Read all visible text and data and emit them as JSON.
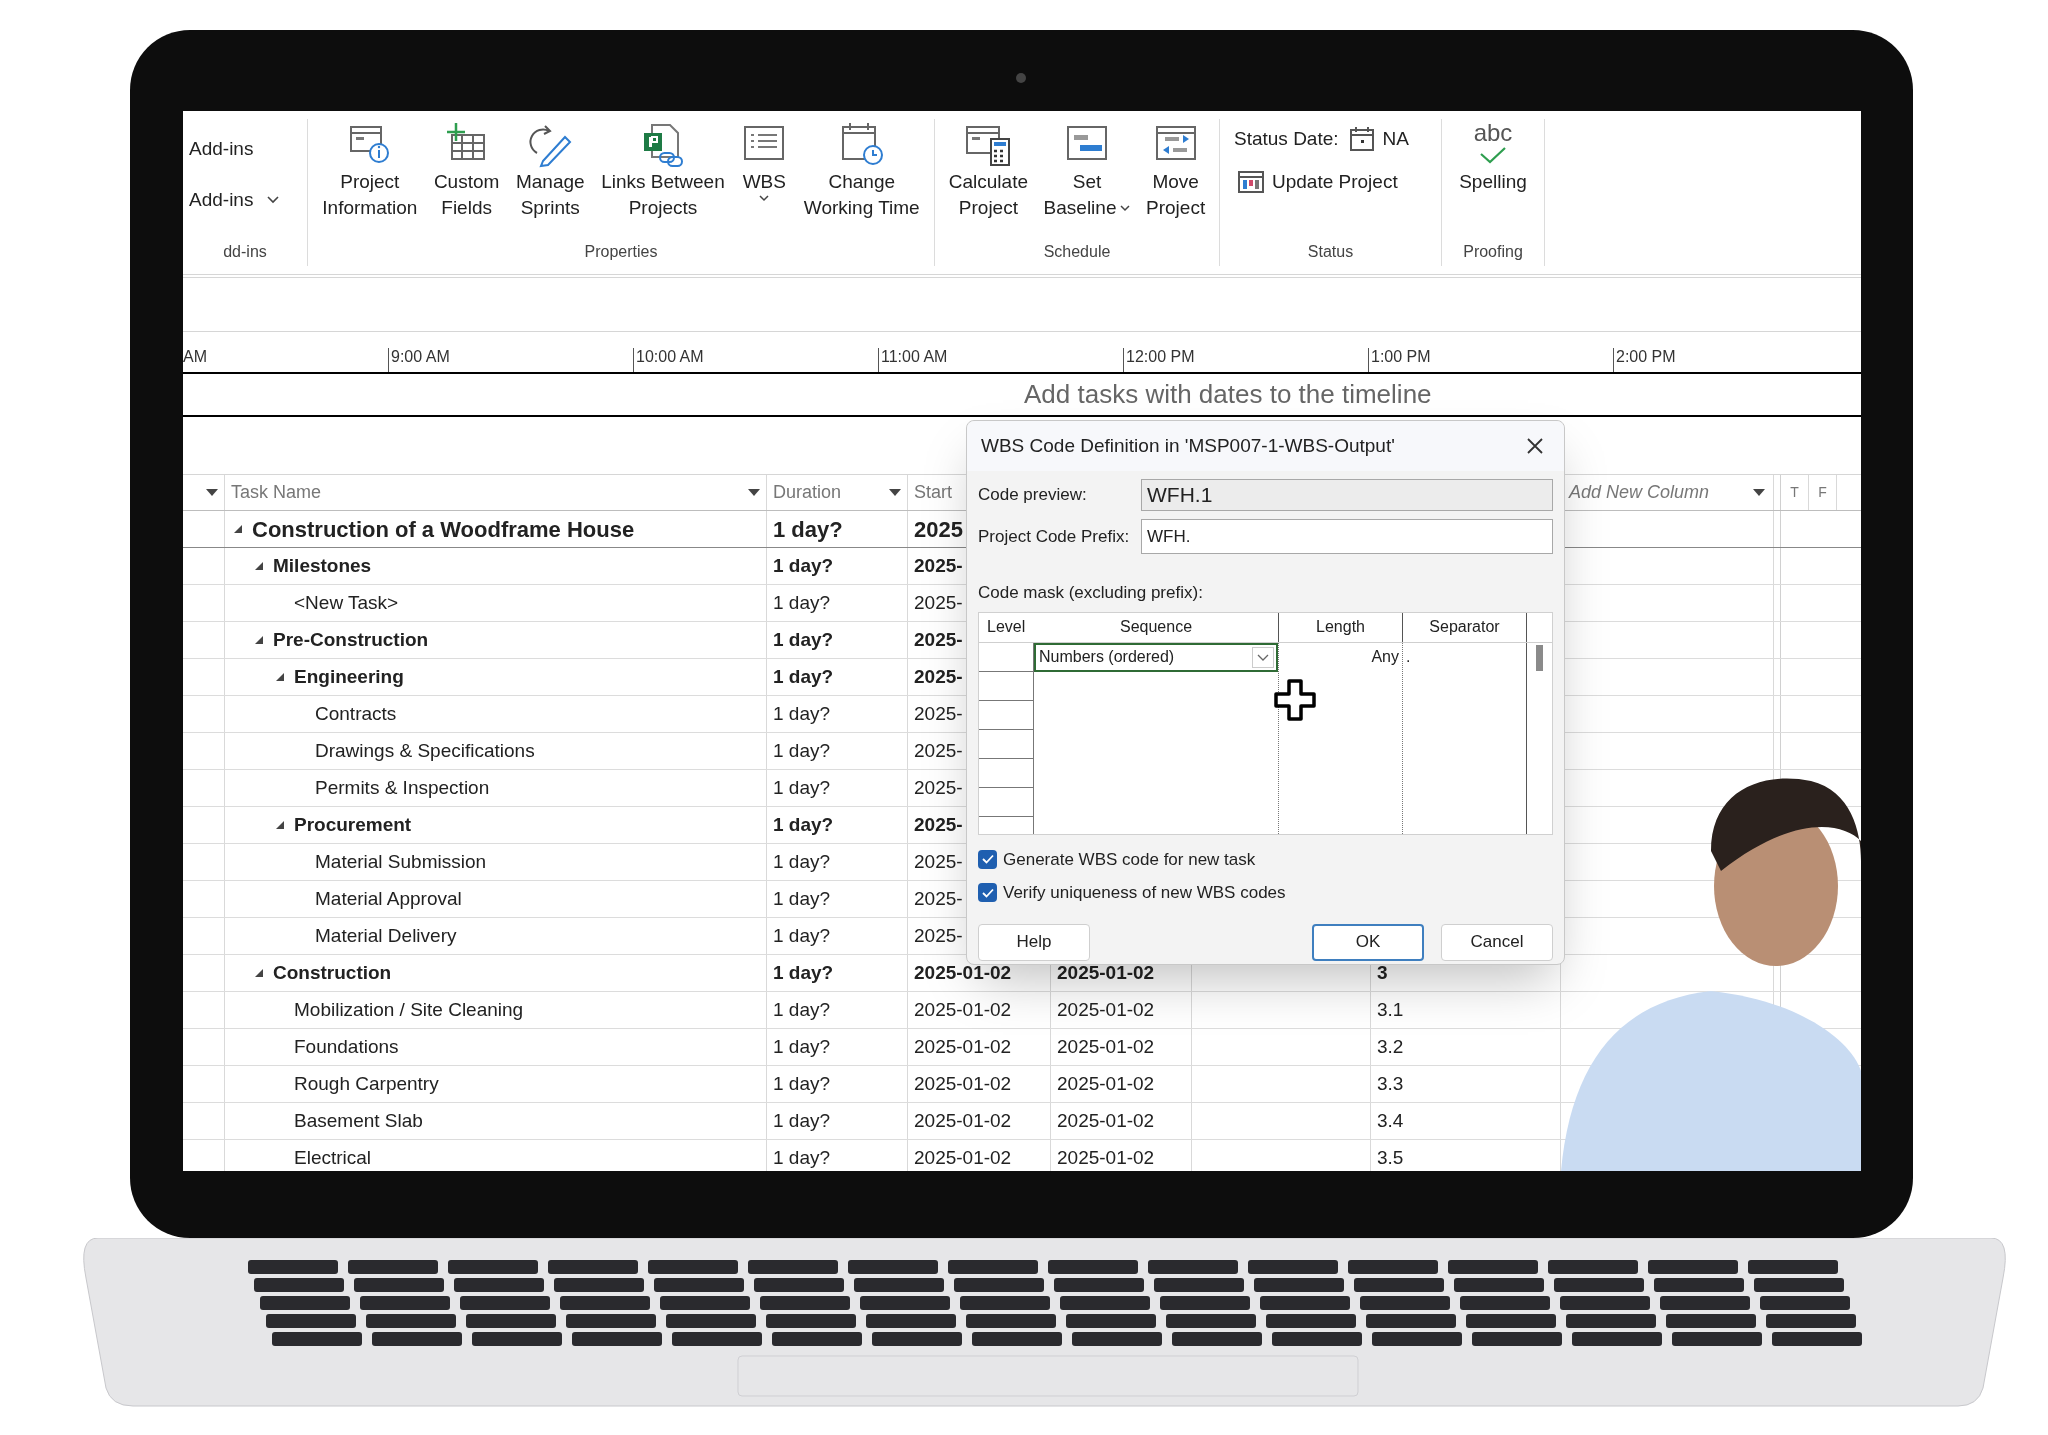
{
  "ribbon": {
    "groups": [
      {
        "label": "dd-ins",
        "kind": "small",
        "items": [
          {
            "lines": [
              "Add-ins"
            ]
          },
          {
            "lines": [
              "Add-ins"
            ],
            "dropdown": true
          }
        ]
      },
      {
        "label": "Properties",
        "kind": "large",
        "items": [
          {
            "lines": [
              "Project",
              "Information"
            ]
          },
          {
            "lines": [
              "Custom",
              "Fields"
            ]
          },
          {
            "lines": [
              "Manage",
              "Sprints"
            ]
          },
          {
            "lines": [
              "Links Between",
              "Projects"
            ]
          },
          {
            "lines": [
              "WBS"
            ],
            "dropdown": true
          },
          {
            "lines": [
              "Change",
              "Working Time"
            ]
          }
        ]
      },
      {
        "label": "Schedule",
        "kind": "large",
        "items": [
          {
            "lines": [
              "Calculate",
              "Project"
            ]
          },
          {
            "lines": [
              "Set",
              "Baseline"
            ],
            "dropdown": true
          },
          {
            "lines": [
              "Move",
              "Project"
            ]
          }
        ]
      },
      {
        "label": "Status",
        "kind": "status",
        "status_date_label": "Status Date:",
        "status_date_value": "NA",
        "update_label": "Update Project"
      },
      {
        "label": "Proofing",
        "kind": "large",
        "items": [
          {
            "lines": [
              "Spelling"
            ],
            "badge": "abc"
          }
        ]
      }
    ]
  },
  "timeline": {
    "scale": [
      "AM",
      "9:00 AM",
      "10:00 AM",
      "11:00 AM",
      "12:00 PM",
      "1:00 PM",
      "2:00 PM"
    ],
    "hint": "Add tasks with dates to the timeline"
  },
  "grid": {
    "columns": {
      "task_name": "Task Name",
      "duration": "Duration",
      "start": "Start",
      "add_new": "Add New Column",
      "gantt_days": [
        "T",
        "F"
      ]
    },
    "rows": [
      {
        "name": "Construction of a Woodframe House",
        "duration": "1 day?",
        "start": "2025",
        "expanded": true,
        "children": [
          {
            "name": "Milestones",
            "duration": "1 day?",
            "start": "2025-",
            "expanded": true,
            "children": [
              {
                "name": "<New Task>",
                "duration": "1 day?",
                "start": "2025-"
              }
            ]
          },
          {
            "name": "Pre-Construction",
            "duration": "1 day?",
            "start": "2025-",
            "expanded": true,
            "children": [
              {
                "name": "Engineering",
                "duration": "1 day?",
                "start": "2025-",
                "expanded": true,
                "children": [
                  {
                    "name": "Contracts",
                    "duration": "1 day?",
                    "start": "2025-"
                  },
                  {
                    "name": "Drawings & Specifications",
                    "duration": "1 day?",
                    "start": "2025-"
                  },
                  {
                    "name": "Permits & Inspection",
                    "duration": "1 day?",
                    "start": "2025-"
                  }
                ]
              },
              {
                "name": "Procurement",
                "duration": "1 day?",
                "start": "2025-",
                "expanded": true,
                "children": [
                  {
                    "name": "Material Submission",
                    "duration": "1 day?",
                    "start": "2025-"
                  },
                  {
                    "name": "Material Approval",
                    "duration": "1 day?",
                    "start": "2025-"
                  },
                  {
                    "name": "Material Delivery",
                    "duration": "1 day?",
                    "start": "2025-"
                  }
                ]
              }
            ]
          },
          {
            "name": "Construction",
            "duration": "1 day?",
            "start": "2025-01-02",
            "finish": "2025-01-02",
            "wbs": "3",
            "expanded": true,
            "children": [
              {
                "name": "Mobilization / Site Cleaning",
                "duration": "1 day?",
                "start": "2025-01-02",
                "finish": "2025-01-02",
                "wbs": "3.1"
              },
              {
                "name": "Foundations",
                "duration": "1 day?",
                "start": "2025-01-02",
                "finish": "2025-01-02",
                "wbs": "3.2"
              },
              {
                "name": "Rough Carpentry",
                "duration": "1 day?",
                "start": "2025-01-02",
                "finish": "2025-01-02",
                "wbs": "3.3"
              },
              {
                "name": "Basement Slab",
                "duration": "1 day?",
                "start": "2025-01-02",
                "finish": "2025-01-02",
                "wbs": "3.4"
              },
              {
                "name": "Electrical",
                "duration": "1 day?",
                "start": "2025-01-02",
                "finish": "2025-01-02",
                "wbs": "3.5"
              }
            ]
          }
        ]
      }
    ]
  },
  "dialog": {
    "title": "WBS Code Definition in 'MSP007-1-WBS-Output'",
    "fields": [
      {
        "label": "Code preview:",
        "value": "WFH.1",
        "readonly": true
      },
      {
        "label": "Project Code Prefix:",
        "value": "WFH.",
        "readonly": false
      }
    ],
    "mask_label": "Code mask (excluding prefix):",
    "mask_columns": [
      "Level",
      "Sequence",
      "Length",
      "Separator"
    ],
    "mask_rows": [
      {
        "sequence": "Numbers (ordered)",
        "length": "Any",
        "separator": "."
      }
    ],
    "checkboxes": [
      {
        "label": "Generate WBS code for new task",
        "checked": true
      },
      {
        "label": "Verify uniqueness of new WBS codes",
        "checked": true
      }
    ],
    "buttons": [
      {
        "label": "Help",
        "default": false
      },
      {
        "label": "OK",
        "default": true
      },
      {
        "label": "Cancel",
        "default": false
      }
    ]
  }
}
